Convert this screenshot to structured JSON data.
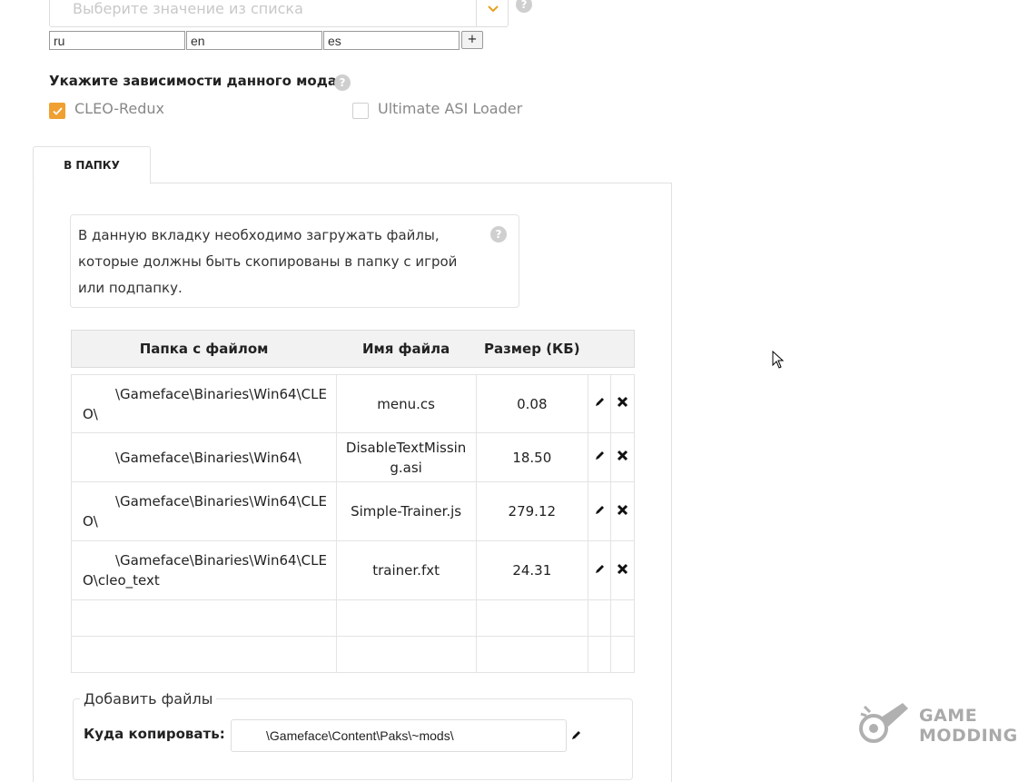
{
  "lang_select": {
    "placeholder": "Выберите значение из списка",
    "help": "?",
    "languages": [
      "ru",
      "en",
      "es"
    ],
    "add_label": "+"
  },
  "dependencies": {
    "title": "Укажите зависимости данного мода",
    "help": "?",
    "items": [
      {
        "label": "CLEO-Redux",
        "checked": true
      },
      {
        "label": "Ultimate ASI Loader",
        "checked": false
      }
    ]
  },
  "tabs": [
    {
      "label": "В ПАПКУ",
      "active": true
    }
  ],
  "info": {
    "text": "В данную вкладку необходимо загружать файлы, которые должны быть скопированы в папку с игрой или подпапку.",
    "help": "?"
  },
  "table": {
    "headers": [
      "Папка с файлом",
      "Имя файла",
      "Размер (КБ)"
    ],
    "rows": [
      {
        "folder": "\\Gameface\\Binaries\\Win64\\CLEO\\",
        "name": "menu.cs",
        "size": "0.08"
      },
      {
        "folder": "\\Gameface\\Binaries\\Win64\\",
        "name": "DisableTextMissing.asi",
        "size": "18.50"
      },
      {
        "folder": "\\Gameface\\Binaries\\Win64\\CLEO\\",
        "name": "Simple-Trainer.js",
        "size": "279.12"
      },
      {
        "folder": "\\Gameface\\Binaries\\Win64\\CLEO\\cleo_text",
        "name": "trainer.fxt",
        "size": "24.31"
      }
    ]
  },
  "add_files": {
    "legend": "Добавить файлы",
    "copy_label": "Куда копировать:",
    "copy_value": "\\Gameface\\Content\\Paks\\~mods\\"
  },
  "icons": {
    "edit": "pencil-icon",
    "delete": "close-icon",
    "check": "check-icon"
  },
  "colors": {
    "accent": "#f0a030",
    "watermark": "#aaaaaa"
  },
  "watermark": {
    "line1": "GAME",
    "line2": "MODDING"
  }
}
